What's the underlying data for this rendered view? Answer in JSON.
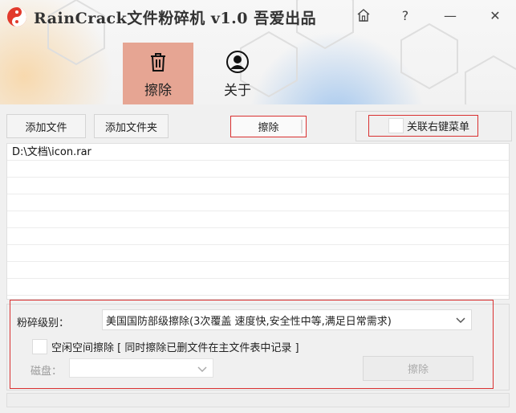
{
  "window": {
    "title": "RainCrack文件粉碎机 v1.0 吾爱出品",
    "home_icon": "home-icon",
    "help_icon": "question-icon",
    "help_glyph": "?",
    "minimize_glyph": "—",
    "close_glyph": "✕"
  },
  "nav": {
    "tabs": [
      {
        "label": "擦除",
        "icon": "trash-icon",
        "active": true
      },
      {
        "label": "关于",
        "icon": "user-icon",
        "active": false
      }
    ],
    "active_color": "#e6a593"
  },
  "toolbar": {
    "add_file_label": "添加文件",
    "add_folder_label": "添加文件夹",
    "erase_label": "擦除",
    "context_menu_label": "关联右键菜单",
    "context_menu_checked": false
  },
  "file_list": {
    "items": [
      "D:\\文档\\icon.rar",
      "",
      "",
      "",
      "",
      "",
      "",
      "",
      ""
    ]
  },
  "options": {
    "level_label": "粉碎级别：",
    "level_value": "美国国防部级擦除(3次覆盖 速度快,安全性中等,满足日常需求)",
    "free_space_label": "空闲空间擦除 [ 同时擦除已删文件在主文件表中记录 ]",
    "free_space_checked": false,
    "disk_label": "磁盘：",
    "disk_value": "",
    "erase_label": "擦除"
  },
  "colors": {
    "highlight_border": "#d93030",
    "logo_red": "#e23a2c"
  }
}
